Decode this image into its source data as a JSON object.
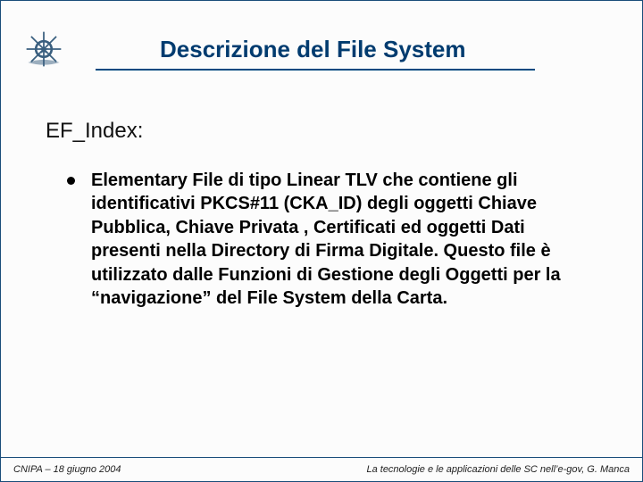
{
  "header": {
    "title": "Descrizione del File System",
    "emblem_name": "italian-republic-emblem"
  },
  "section": {
    "heading": "EF_Index:"
  },
  "bullets": [
    {
      "text": "Elementary File di tipo Linear TLV che contiene gli identificativi PKCS#11 (CKA_ID)  degli oggetti Chiave Pubblica, Chiave Privata , Certificati ed oggetti Dati presenti nella Directory di Firma Digitale. Questo file è  utilizzato dalle Funzioni di Gestione degli Oggetti per la “navigazione” del File System della Carta."
    }
  ],
  "footer": {
    "left": "CNIPA – 18 giugno 2004",
    "right": "La tecnologie e le applicazioni delle SC nell’e-gov, G. Manca"
  }
}
